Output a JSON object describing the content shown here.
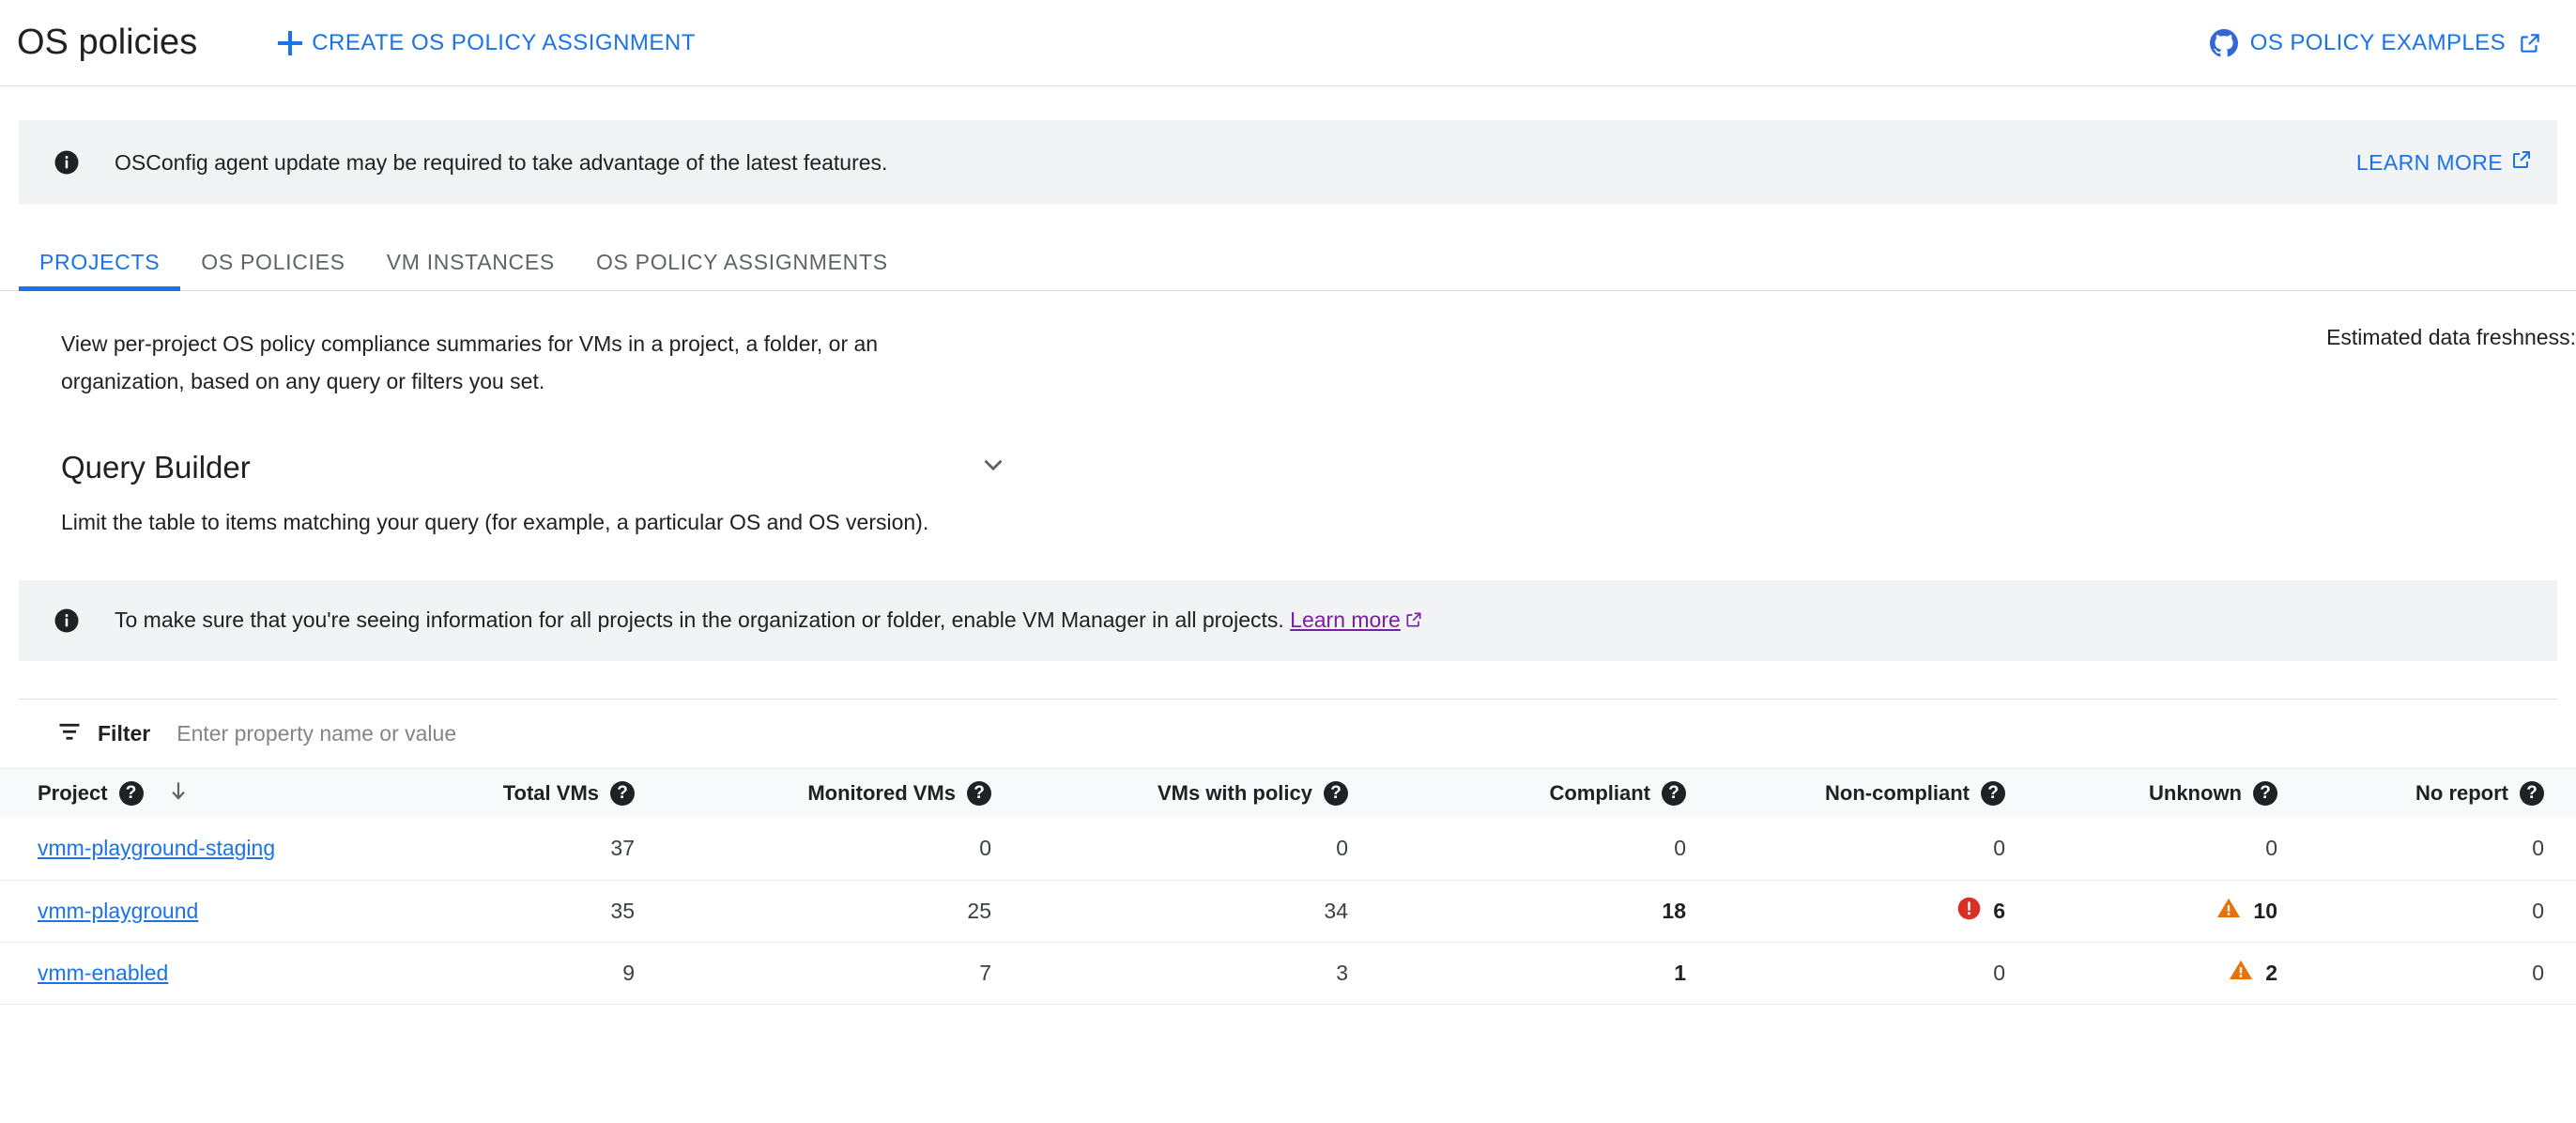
{
  "header": {
    "title": "OS policies",
    "create_button": "CREATE OS POLICY ASSIGNMENT",
    "examples_link": "OS POLICY EXAMPLES",
    "github_icon": "github-icon",
    "external_icon": "external-link-icon",
    "plus_icon": "plus-icon"
  },
  "banner_top": {
    "icon": "info-icon",
    "text": "OSConfig agent update may be required to take advantage of the latest features.",
    "action": "LEARN MORE"
  },
  "tabs": [
    {
      "label": "PROJECTS",
      "active": true
    },
    {
      "label": "OS POLICIES",
      "active": false
    },
    {
      "label": "VM INSTANCES",
      "active": false
    },
    {
      "label": "OS POLICY ASSIGNMENTS",
      "active": false
    }
  ],
  "description": {
    "line1": "View per-project OS policy compliance summaries for VMs in a project, a folder, or an",
    "line2": "organization, based on any query or filters you set.",
    "freshness_label": "Estimated data freshness:"
  },
  "query_builder": {
    "title": "Query Builder",
    "chevron_icon": "chevron-down-icon",
    "subtitle": "Limit the table to items matching your query (for example, a particular OS and OS version)."
  },
  "banner_bottom": {
    "icon": "info-icon",
    "text_before": "To make sure that you're seeing information for all projects in the organization or folder, enable VM Manager in all projects.",
    "link": "Learn more"
  },
  "filter": {
    "icon": "filter-icon",
    "label": "Filter",
    "placeholder": "Enter property name or value",
    "value": ""
  },
  "table": {
    "columns": [
      {
        "label": "Project",
        "help": "?",
        "sorted": true,
        "sort_icon": "arrow-down-icon"
      },
      {
        "label": "Total VMs",
        "help": "?"
      },
      {
        "label": "Monitored VMs",
        "help": "?"
      },
      {
        "label": "VMs with policy",
        "help": "?"
      },
      {
        "label": "Compliant",
        "help": "?"
      },
      {
        "label": "Non-compliant",
        "help": "?"
      },
      {
        "label": "Unknown",
        "help": "?"
      },
      {
        "label": "No report",
        "help": "?"
      }
    ],
    "rows": [
      {
        "project": "vmm-playground-staging",
        "total_vms": "37",
        "monitored_vms": "0",
        "vms_with_policy": "0",
        "compliant": "0",
        "non_compliant": "0",
        "non_compliant_icon": "",
        "unknown": "0",
        "unknown_icon": "",
        "no_report": "0"
      },
      {
        "project": "vmm-playground",
        "total_vms": "35",
        "monitored_vms": "25",
        "vms_with_policy": "34",
        "compliant": "18",
        "non_compliant": "6",
        "non_compliant_icon": "error-circle-icon",
        "unknown": "10",
        "unknown_icon": "warning-triangle-icon",
        "no_report": "0"
      },
      {
        "project": "vmm-enabled",
        "total_vms": "9",
        "monitored_vms": "7",
        "vms_with_policy": "3",
        "compliant": "1",
        "non_compliant": "0",
        "non_compliant_icon": "",
        "unknown": "2",
        "unknown_icon": "warning-triangle-icon",
        "no_report": "0"
      }
    ]
  },
  "colors": {
    "accent_blue": "#1a73e8",
    "visited_purple": "#7b1fa2",
    "error_red": "#d93025",
    "warning_orange": "#e8710a",
    "banner_bg": "#f1f3f4",
    "header_bg": "#f8f9fa",
    "muted_text": "#80868b"
  }
}
